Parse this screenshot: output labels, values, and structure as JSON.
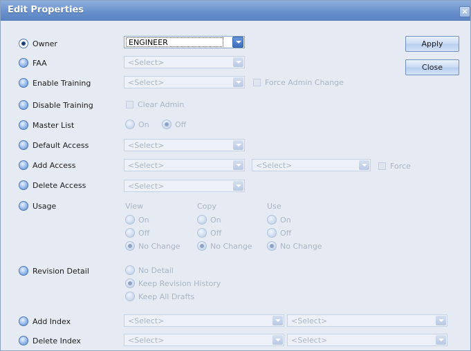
{
  "window": {
    "title": "Edit Properties",
    "close_label": "×"
  },
  "buttons": {
    "apply": "Apply",
    "close": "Close"
  },
  "rows": {
    "owner": {
      "label": "Owner",
      "value": "ENGINEER"
    },
    "faa": {
      "label": "FAA",
      "value": "<Select>"
    },
    "enable_training": {
      "label": "Enable Training",
      "value": "<Select>",
      "check_label": "Force Admin Change"
    },
    "disable_training": {
      "label": "Disable Training",
      "check_label": "Clear Admin"
    },
    "master_list": {
      "label": "Master List",
      "opt_on": "On",
      "opt_off": "Off"
    },
    "default_access": {
      "label": "Default Access",
      "value": "<Select>"
    },
    "add_access": {
      "label": "Add Access",
      "value1": "<Select>",
      "value2": "<Select>",
      "check_label": "Force"
    },
    "delete_access": {
      "label": "Delete Access",
      "value": "<Select>"
    },
    "usage": {
      "label": "Usage",
      "groups": [
        {
          "header": "View",
          "on": "On",
          "off": "Off",
          "nochange": "No Change"
        },
        {
          "header": "Copy",
          "on": "On",
          "off": "Off",
          "nochange": "No Change"
        },
        {
          "header": "Use",
          "on": "On",
          "off": "Off",
          "nochange": "No Change"
        }
      ]
    },
    "revision_detail": {
      "label": "Revision Detail",
      "opt1": "No Detail",
      "opt2": "Keep Revision History",
      "opt3": "Keep All Drafts"
    },
    "add_index": {
      "label": "Add Index",
      "value1": "<Select>",
      "value2": "<Select>"
    },
    "delete_index": {
      "label": "Delete Index",
      "value1": "<Select>",
      "value2": "<Select>"
    }
  },
  "colors": {
    "titlebar": "#6a91cc",
    "background": "#e6ebf3",
    "accent": "#3d6fbf"
  }
}
